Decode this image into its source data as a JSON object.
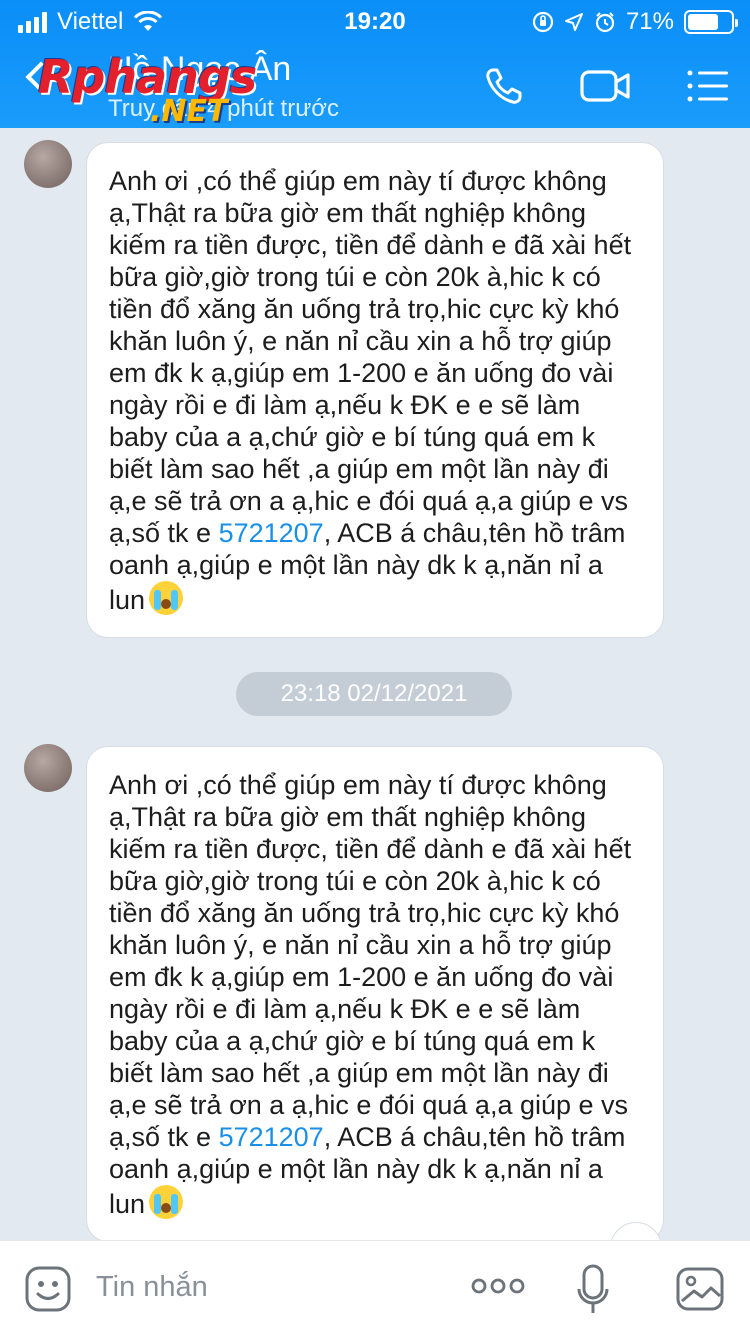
{
  "status_bar": {
    "carrier": "Viettel",
    "time": "19:20",
    "battery_percent": "71%",
    "battery_level": 0.71
  },
  "header": {
    "contact_name": "Hồng Ngọc Ân",
    "contact_name_visible": "Hồ    Ngọc Ân",
    "last_seen": "Truy cập 4 phút trước",
    "watermark_main": "Rphangs",
    "watermark_sub": ".NET",
    "icons": [
      "back-chevron-icon",
      "phone-icon",
      "video-call-icon",
      "menu-icon"
    ]
  },
  "messages": [
    {
      "text_before": "Anh ơi ,có thể giúp em này tí được không ạ,Thật ra bữa giờ em thất nghiệp không kiếm ra tiền được, tiền để dành e đã xài hết bữa giờ,giờ trong túi e còn 20k à,hic k có tiền đổ xăng ăn uống trả trọ,hic cực kỳ khó khăn luôn ý, e năn nỉ cầu xin a hỗ trợ giúp em đk k ạ,giúp em 1-200 e ăn uống đo vài ngày rồi e đi làm ạ,nếu k ĐK e e sẽ làm baby của a ạ,chứ giờ e bí túng quá em k biết làm sao hết ,a giúp em một lần này đi ạ,e sẽ trả ơn a ạ,hic e đói quá ạ,a giúp e vs ạ,số tk e ",
      "account_number": "5721207",
      "text_after": ", ACB á châu,tên hồ trâm oanh ạ,giúp e một lần này dk k ạ,năn nỉ a lun",
      "emoji": "crying-face-icon"
    },
    {
      "text_before": "Anh ơi ,có thể giúp em này tí được không ạ,Thật ra bữa giờ em thất nghiệp không kiếm ra tiền được, tiền để dành e đã xài hết bữa giờ,giờ trong túi e còn 20k à,hic k có tiền đổ xăng ăn uống trả trọ,hic cực kỳ khó khăn luôn ý, e năn nỉ cầu xin a hỗ trợ giúp em đk k ạ,giúp em 1-200 e ăn uống đo vài ngày rồi e đi làm ạ,nếu k ĐK e e sẽ làm baby của a ạ,chứ giờ e bí túng quá em k biết làm sao hết ,a giúp em một lần này đi ạ,e sẽ trả ơn a ạ,hic e đói quá ạ,a giúp e vs ạ,số tk e ",
      "account_number": "5721207",
      "text_after": ", ACB á châu,tên hồ trâm oanh ạ,giúp e một lần này dk k ạ,năn nỉ a lun",
      "emoji": "crying-face-icon"
    }
  ],
  "timestamp_divider": "23:18 02/12/2021",
  "composer": {
    "placeholder": "Tin nhắn",
    "icons": [
      "sticker-icon",
      "more-options-icon",
      "microphone-icon",
      "image-icon"
    ]
  }
}
